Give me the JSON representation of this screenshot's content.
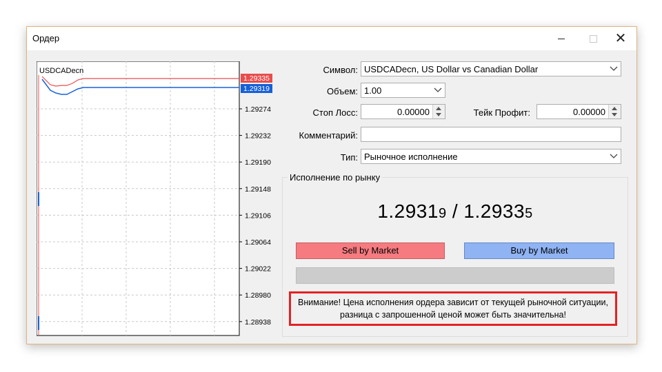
{
  "window": {
    "title": "Ордер"
  },
  "chart": {
    "symbol": "USDCADecn",
    "ask_tag": "1.29335",
    "bid_tag": "1.29319",
    "ticks": [
      "1.29274",
      "1.29232",
      "1.29190",
      "1.29148",
      "1.29106",
      "1.29064",
      "1.29022",
      "1.28980",
      "1.28938"
    ],
    "ask_color": "#e84c4c",
    "bid_color": "#1560d8"
  },
  "form": {
    "symbol_label": "Символ:",
    "symbol_value": "USDCADecn, US Dollar vs Canadian Dollar",
    "volume_label": "Объем:",
    "volume_value": "1.00",
    "stoploss_label": "Стоп Лосс:",
    "stoploss_value": "0.00000",
    "takeprofit_label": "Тейк Профит:",
    "takeprofit_value": "0.00000",
    "comment_label": "Комментарий:",
    "comment_value": "",
    "type_label": "Тип:",
    "type_value": "Рыночное исполнение"
  },
  "execution": {
    "group_title": "Исполнение по рынку",
    "bid_main": "1.2931",
    "bid_small": "9",
    "separator": " / ",
    "ask_main": "1.2933",
    "ask_small": "5",
    "sell_label": "Sell by Market",
    "buy_label": "Buy by Market",
    "sell_color": "#f57b80",
    "buy_color": "#8fb3f3",
    "warning_line1": "Внимание! Цена исполнения ордера зависит от текущей рыночной ситуации,",
    "warning_line2": "разница с запрошенной ценой может быть значительна!"
  }
}
